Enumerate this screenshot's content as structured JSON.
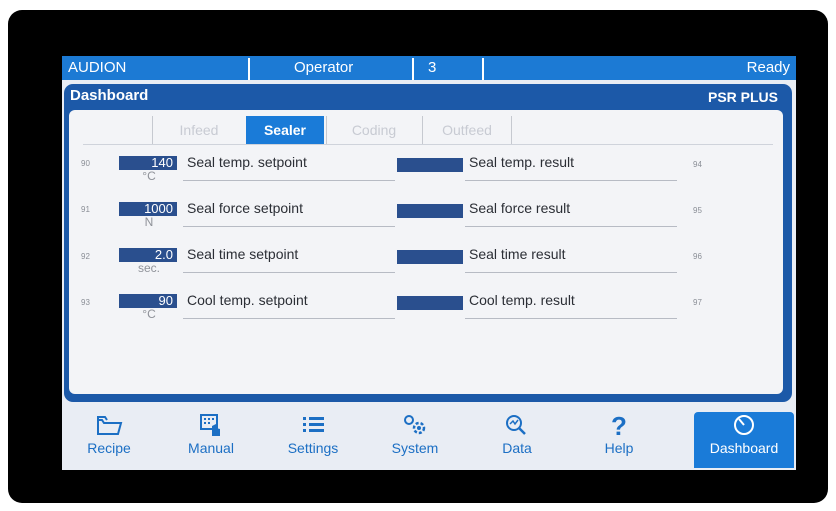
{
  "status": {
    "app": "AUDION",
    "user": "Operator",
    "level": "3",
    "state": "Ready"
  },
  "panel": {
    "title": "Dashboard",
    "model": "PSR PLUS"
  },
  "tabs": [
    {
      "label": "Infeed",
      "active": false
    },
    {
      "label": "Sealer",
      "active": true
    },
    {
      "label": "Coding",
      "active": false
    },
    {
      "label": "Outfeed",
      "active": false
    }
  ],
  "rows": [
    {
      "num": "90",
      "value": "140",
      "unit": "°C",
      "setpoint": "Seal temp. setpoint",
      "result": "Seal temp. result",
      "rnum": "94"
    },
    {
      "num": "91",
      "value": "1000",
      "unit": "N",
      "setpoint": "Seal force setpoint",
      "result": "Seal force result",
      "rnum": "95"
    },
    {
      "num": "92",
      "value": "2.0",
      "unit": "sec.",
      "setpoint": "Seal time setpoint",
      "result": "Seal time result",
      "rnum": "96"
    },
    {
      "num": "93",
      "value": "90",
      "unit": "°C",
      "setpoint": "Cool temp. setpoint",
      "result": "Cool temp. result",
      "rnum": "97"
    }
  ],
  "nav": [
    {
      "label": "Recipe",
      "icon": "folder-icon"
    },
    {
      "label": "Manual",
      "icon": "hand-keypad-icon"
    },
    {
      "label": "Settings",
      "icon": "list-icon"
    },
    {
      "label": "System",
      "icon": "gears-icon"
    },
    {
      "label": "Data",
      "icon": "data-search-icon"
    },
    {
      "label": "Help",
      "icon": "question-icon"
    },
    {
      "label": "Dashboard",
      "icon": "gauge-icon",
      "active": true
    }
  ]
}
